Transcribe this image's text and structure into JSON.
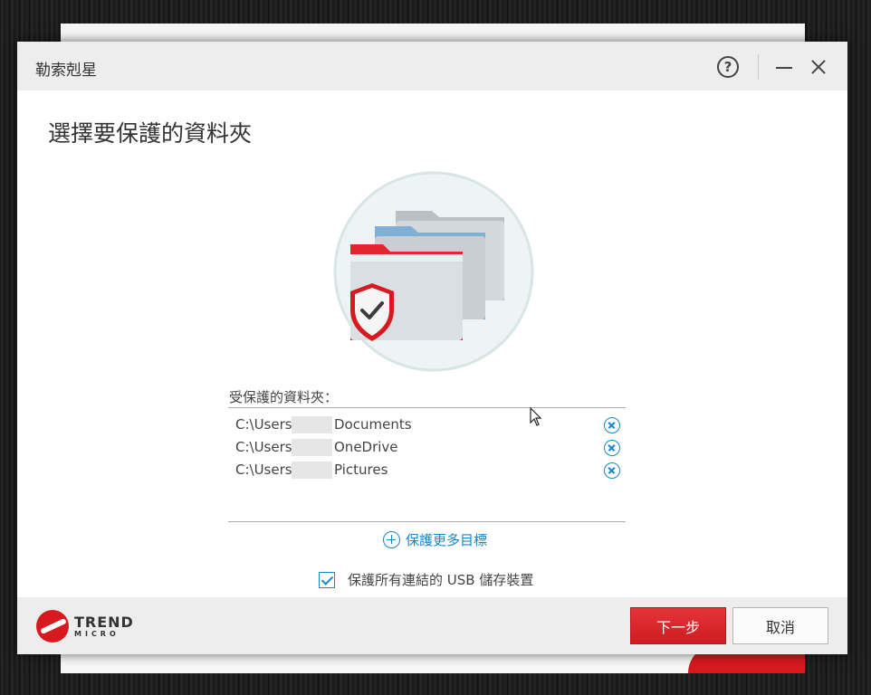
{
  "window": {
    "title": "勒索剋星",
    "help_label": "?"
  },
  "page": {
    "heading": "選擇要保護的資料夾"
  },
  "protected": {
    "label": "受保護的資料夾：",
    "folders": [
      {
        "prefix": "C:\\Users\\",
        "name": "Documents"
      },
      {
        "prefix": "C:\\Users\\",
        "name": "OneDrive"
      },
      {
        "prefix": "C:\\Users\\",
        "name": "Pictures"
      }
    ]
  },
  "add_more_label": "保護更多目標",
  "usb": {
    "label": "保護所有連結的 USB 儲存裝置",
    "checked": true
  },
  "footer": {
    "brand_line1": "TREND",
    "brand_line2": "MICRO",
    "next_label": "下一步",
    "cancel_label": "取消"
  },
  "colors": {
    "accent_blue": "#1b86c4",
    "brand_red": "#d71920"
  }
}
